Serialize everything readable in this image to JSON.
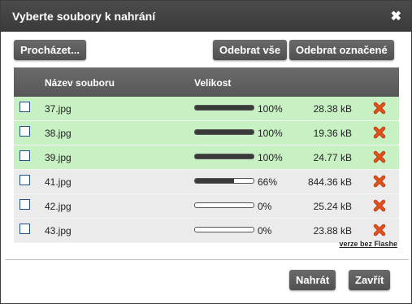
{
  "dialog": {
    "title": "Vyberte soubory k nahrání",
    "close_glyph": "✖"
  },
  "toolbar": {
    "browse_label": "Procházet...",
    "remove_all_label": "Odebrat vše",
    "remove_selected_label": "Odebrat označené"
  },
  "table": {
    "col_name": "Název souboru",
    "col_size": "Velikost",
    "rows": [
      {
        "name": "37.jpg",
        "progress": 100,
        "percent": "100%",
        "size": "28.38 kB",
        "status": "done"
      },
      {
        "name": "38.jpg",
        "progress": 100,
        "percent": "100%",
        "size": "19.36 kB",
        "status": "done"
      },
      {
        "name": "39.jpg",
        "progress": 100,
        "percent": "100%",
        "size": "24.77 kB",
        "status": "done"
      },
      {
        "name": "41.jpg",
        "progress": 66,
        "percent": "66%",
        "size": "844.36 kB",
        "status": "pending"
      },
      {
        "name": "42.jpg",
        "progress": 0,
        "percent": "0%",
        "size": "25.24 kB",
        "status": "pending"
      },
      {
        "name": "43.jpg",
        "progress": 0,
        "percent": "0%",
        "size": "23.88 kB",
        "status": "pending"
      }
    ]
  },
  "no_flash_link": "verze bez Flashe",
  "footer": {
    "upload_label": "Nahrát",
    "close_label": "Zavřít"
  },
  "colors": {
    "done_row": "#c7f0c3",
    "pending_row": "#ecebec",
    "delete_icon": "#e0521d"
  },
  "icons": {
    "delete": "delete-x-icon",
    "checkbox": "checkbox"
  }
}
